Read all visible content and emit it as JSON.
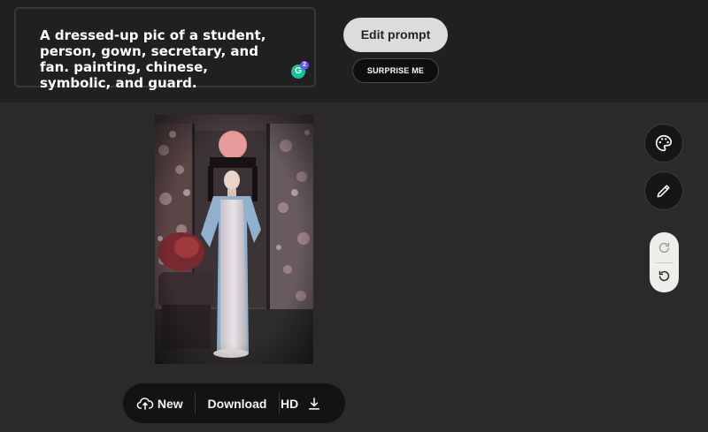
{
  "prompt": {
    "text": "A dressed-up pic of a student, person, gown, secretary, and fan. painting, chinese, symbolic, and guard.",
    "grammarly_letter": "G",
    "grammarly_count": "2"
  },
  "header": {
    "edit_prompt_label": "Edit prompt",
    "surprise_label": "SURPRISE ME"
  },
  "canvas": {
    "image_icon": "generated-painting"
  },
  "side_tools": {
    "palette_icon": "palette-icon",
    "pencil_icon": "pencil-icon",
    "redo_icon": "redo-icon",
    "undo_icon": "undo-icon"
  },
  "bottom_bar": {
    "new_label": "New",
    "download_label": "Download",
    "hd_label": "HD"
  },
  "colors": {
    "background": "#2b2929",
    "topbar": "#221f20",
    "button_light": "#dcdcdc",
    "toolbar_dark": "#141212"
  }
}
